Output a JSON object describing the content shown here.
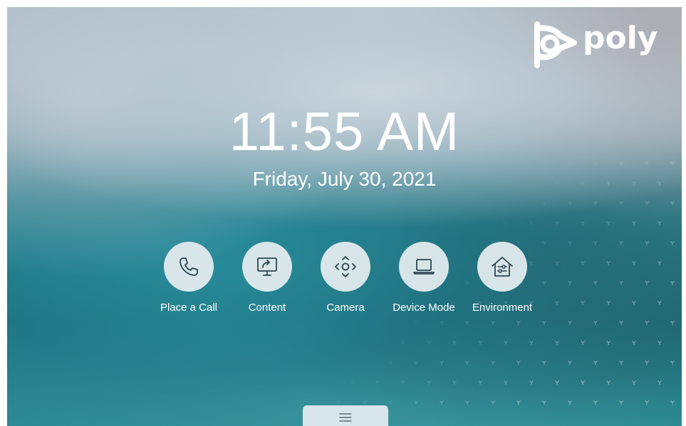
{
  "brand": {
    "name": "poly",
    "color": "#ffffff"
  },
  "clock": {
    "time": "11:55 AM",
    "date": "Friday, July 30, 2021"
  },
  "actions": [
    {
      "label": "Place a Call",
      "icon": "phone-icon"
    },
    {
      "label": "Content",
      "icon": "share-screen-icon"
    },
    {
      "label": "Camera",
      "icon": "camera-control-icon"
    },
    {
      "label": "Device Mode",
      "icon": "laptop-icon"
    },
    {
      "label": "Environment",
      "icon": "home-controls-icon"
    }
  ],
  "tray": {
    "icon": "menu-icon"
  },
  "colors": {
    "button_bg": "#e2ebee",
    "icon_stroke": "#2b4650",
    "text": "#ffffff"
  }
}
